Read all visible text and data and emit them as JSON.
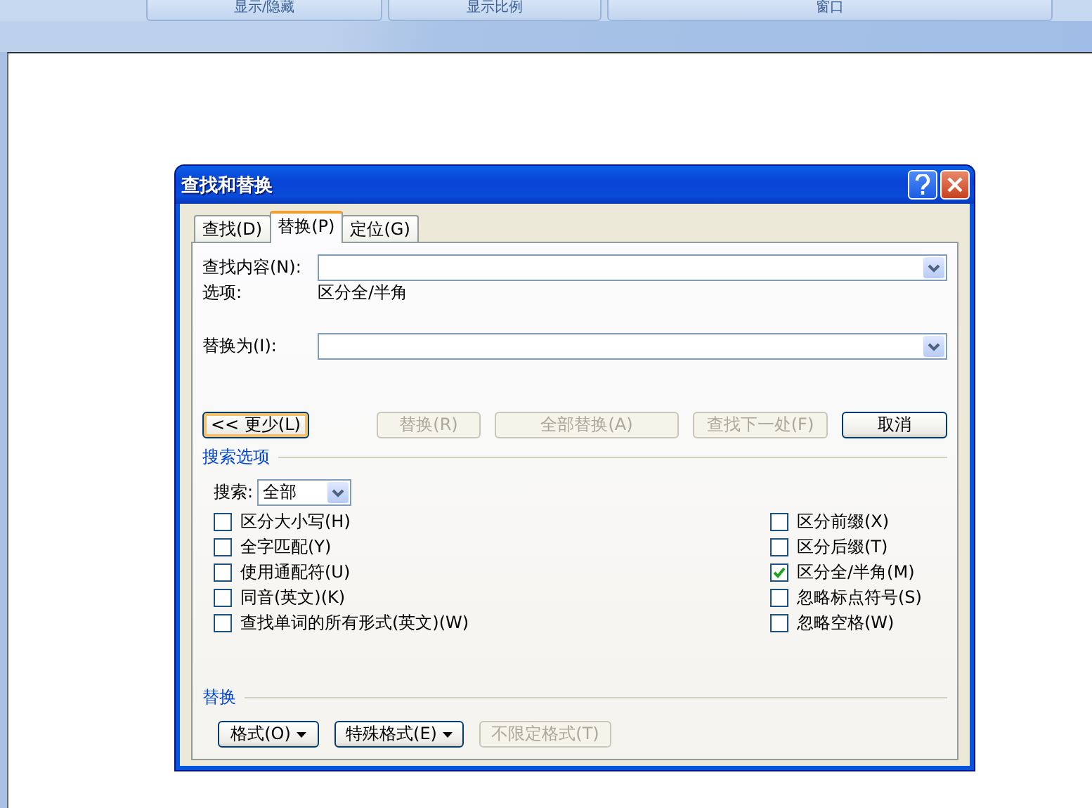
{
  "ribbon": {
    "groups": [
      {
        "label": "显示/隐藏"
      },
      {
        "label": "显示比例"
      },
      {
        "label": "窗口"
      }
    ]
  },
  "dialog": {
    "title": "查找和替换",
    "tabs": [
      {
        "label": "查找(D)",
        "selected": false
      },
      {
        "label": "替换(P)",
        "selected": true
      },
      {
        "label": "定位(G)",
        "selected": false
      }
    ],
    "find_label": "查找内容(N):",
    "options_label": "选项:",
    "options_value": "区分全/半角",
    "replace_label": "替换为(I):",
    "buttons": [
      {
        "label": "<< 更少(L)",
        "disabled": false,
        "default": true
      },
      {
        "label": "替换(R)",
        "disabled": true,
        "default": false
      },
      {
        "label": "全部替换(A)",
        "disabled": true,
        "default": false
      },
      {
        "label": "查找下一处(F)",
        "disabled": true,
        "default": false
      },
      {
        "label": "取消",
        "disabled": false,
        "default": false
      }
    ],
    "search_options": {
      "title": "搜索选项",
      "search_label": "搜索:",
      "search_value": "全部",
      "left": [
        {
          "label": "区分大小写(H)",
          "checked": false
        },
        {
          "label": "全字匹配(Y)",
          "checked": false
        },
        {
          "label": "使用通配符(U)",
          "checked": false
        },
        {
          "label": "同音(英文)(K)",
          "checked": false
        },
        {
          "label": "查找单词的所有形式(英文)(W)",
          "checked": false
        }
      ],
      "right": [
        {
          "label": "区分前缀(X)",
          "checked": false
        },
        {
          "label": "区分后缀(T)",
          "checked": false
        },
        {
          "label": "区分全/半角(M)",
          "checked": true
        },
        {
          "label": "忽略标点符号(S)",
          "checked": false
        },
        {
          "label": "忽略空格(W)",
          "checked": false
        }
      ]
    },
    "replace_section": {
      "title": "替换",
      "buttons": [
        {
          "label": "格式(O)",
          "disabled": false,
          "menu": true
        },
        {
          "label": "特殊格式(E)",
          "disabled": false,
          "menu": true
        },
        {
          "label": "不限定格式(T)",
          "disabled": true,
          "menu": false
        }
      ]
    }
  }
}
